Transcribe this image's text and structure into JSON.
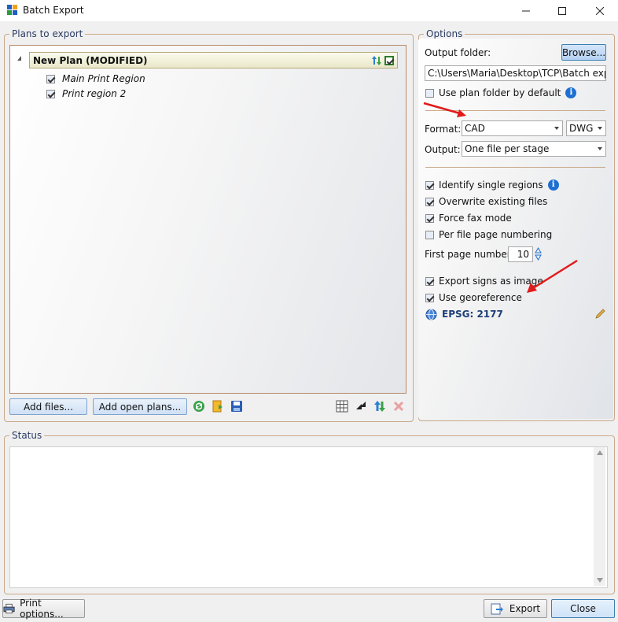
{
  "window": {
    "title": "Batch Export"
  },
  "plans": {
    "legend": "Plans to export",
    "plan_name": "New Plan (MODIFIED)",
    "regions": [
      {
        "label": "Main Print Region",
        "checked": true
      },
      {
        "label": "Print region 2",
        "checked": true
      }
    ],
    "add_files_label": "Add files...",
    "add_open_plans_label": "Add open plans..."
  },
  "options": {
    "legend": "Options",
    "output_folder_label": "Output folder:",
    "browse_label": "Browse...",
    "output_folder_value": "C:\\Users\\Maria\\Desktop\\TCP\\Batch export",
    "use_plan_folder_label": "Use plan folder by default",
    "format_label": "Format:",
    "format_value": "CAD",
    "format_sub_value": "DWG",
    "output_label": "Output:",
    "output_value": "One file per stage",
    "identify_single_regions_label": "Identify single regions",
    "overwrite_existing_files_label": "Overwrite existing files",
    "force_fax_mode_label": "Force fax mode",
    "per_file_page_numbering_label": "Per file page numbering",
    "first_page_number_label": "First page number:",
    "first_page_number_value": "10",
    "export_signs_as_image_label": "Export signs as image",
    "use_georeference_label": "Use georeference",
    "epsg_label": "EPSG: 2177"
  },
  "status": {
    "legend": "Status"
  },
  "footer": {
    "print_options_label": "Print options...",
    "export_label": "Export",
    "close_label": "Close"
  },
  "colors": {
    "annotation_arrow": "#e01b1b",
    "accent_blue": "#1e6fd1",
    "group_border": "#c9a98a"
  }
}
